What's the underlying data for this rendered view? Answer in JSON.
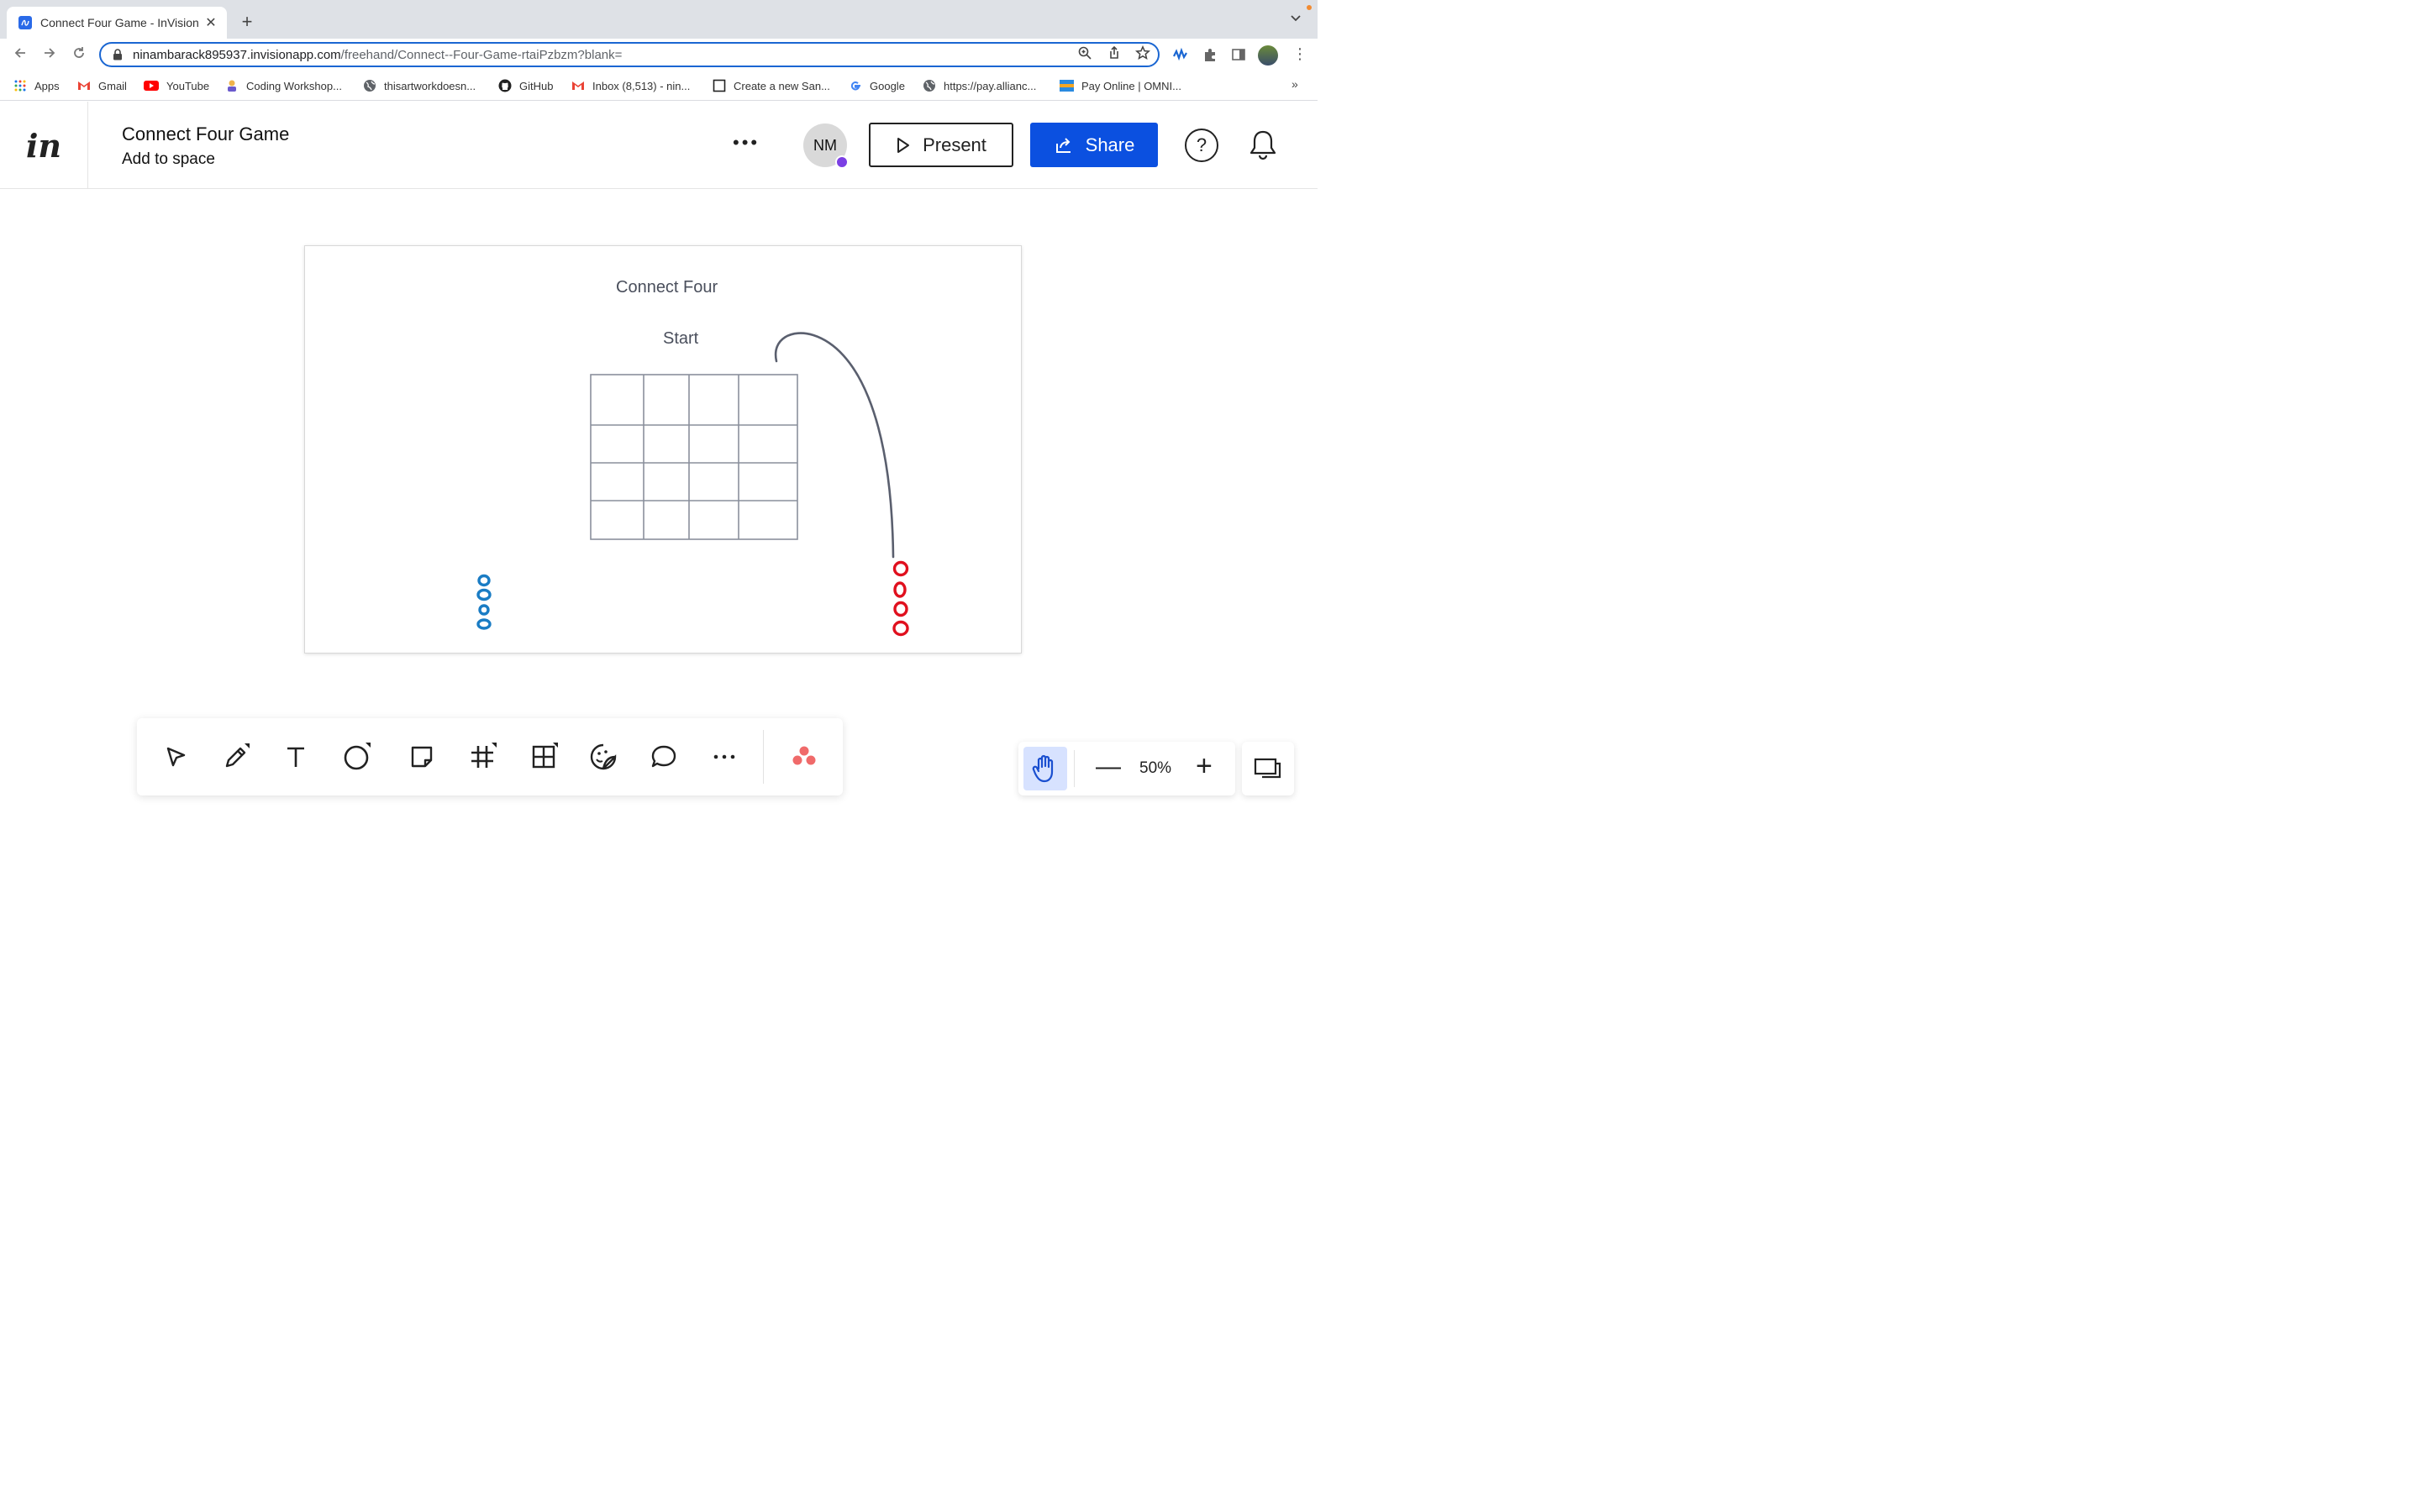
{
  "browser": {
    "tab_title": "Connect Four Game - InVision",
    "new_tab_label": "+",
    "url_domain": "ninambarack895937.invisionapp.com",
    "url_path": "/freehand/Connect--Four-Game-rtaiPzbzm?blank=",
    "bookmarks": [
      {
        "label": "Apps",
        "icon": "apps-grid-icon"
      },
      {
        "label": "Gmail",
        "icon": "gmail-icon"
      },
      {
        "label": "YouTube",
        "icon": "youtube-icon"
      },
      {
        "label": "Coding Workshop...",
        "icon": "workshop-icon"
      },
      {
        "label": "thisartworkdoesn...",
        "icon": "globe-icon"
      },
      {
        "label": "GitHub",
        "icon": "github-icon"
      },
      {
        "label": "Inbox (8,513) - nin...",
        "icon": "gmail-icon"
      },
      {
        "label": "Create a new San...",
        "icon": "square-icon"
      },
      {
        "label": "Google",
        "icon": "google-icon"
      },
      {
        "label": "https://pay.allianc...",
        "icon": "globe-icon"
      },
      {
        "label": "Pay Online | OMNI...",
        "icon": "omni-icon"
      }
    ],
    "bookmarks_more": "»"
  },
  "app": {
    "logo": "in",
    "doc_title": "Connect Four Game",
    "space_label": "Add to space",
    "more_label": "•••",
    "avatar_initials": "NM",
    "present_label": "Present",
    "share_label": "Share",
    "help_label": "?"
  },
  "board": {
    "title": "Connect Four",
    "start_label": "Start",
    "grid_cols": 4,
    "grid_rows": 4,
    "blue_pieces": 4,
    "red_pieces": 4,
    "colors": {
      "blue": "#1a7cc4",
      "red": "#e0101e",
      "grid": "#8a8f9c",
      "arrow": "#5a5f6e"
    }
  },
  "tools": [
    {
      "name": "select-tool",
      "icon": "cursor-icon"
    },
    {
      "name": "pen-tool",
      "icon": "pencil-icon"
    },
    {
      "name": "text-tool",
      "icon": "text-icon"
    },
    {
      "name": "shape-tool",
      "icon": "circle-icon"
    },
    {
      "name": "sticky-note-tool",
      "icon": "sticky-note-icon"
    },
    {
      "name": "frame-tool",
      "icon": "hash-icon"
    },
    {
      "name": "table-tool",
      "icon": "grid-icon"
    },
    {
      "name": "sticker-tool",
      "icon": "sticker-icon"
    },
    {
      "name": "comment-tool",
      "icon": "comment-icon"
    },
    {
      "name": "more-tool",
      "icon": "more-icon"
    },
    {
      "name": "apps-tool",
      "icon": "asana-icon"
    }
  ],
  "zoom": {
    "level": "50%",
    "minus": "—",
    "plus": "+"
  }
}
